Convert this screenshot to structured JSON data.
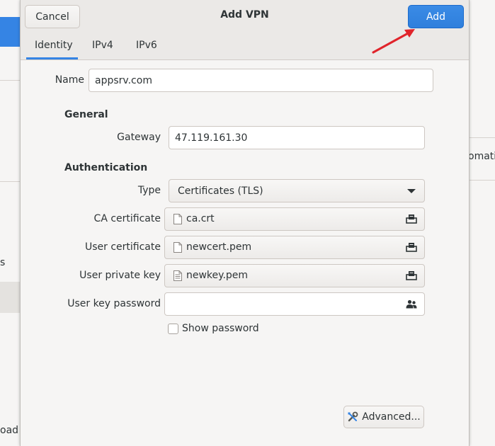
{
  "background": {
    "left_partial_text": "s",
    "bottom_left_partial_text": "oad",
    "right_partial_text": "omatic"
  },
  "dialog": {
    "title": "Add VPN",
    "cancel_label": "Cancel",
    "add_label": "Add",
    "tabs": [
      {
        "label": "Identity",
        "active": true
      },
      {
        "label": "IPv4",
        "active": false
      },
      {
        "label": "IPv6",
        "active": false
      }
    ],
    "name_label": "Name",
    "name_value": "appsrv.com",
    "general_header": "General",
    "gateway_label": "Gateway",
    "gateway_value": "47.119.161.30",
    "auth_header": "Authentication",
    "type_label": "Type",
    "type_value": "Certificates (TLS)",
    "ca_label": "CA certificate",
    "ca_value": "ca.crt",
    "user_cert_label": "User certificate",
    "user_cert_value": "newcert.pem",
    "user_key_label": "User private key",
    "user_key_value": "newkey.pem",
    "key_password_label": "User key password",
    "key_password_value": "",
    "show_password_label": "Show password",
    "show_password_checked": false,
    "advanced_label": "Advanced..."
  },
  "colors": {
    "accent": "#3584e4",
    "annotation_arrow": "#e0242b"
  }
}
